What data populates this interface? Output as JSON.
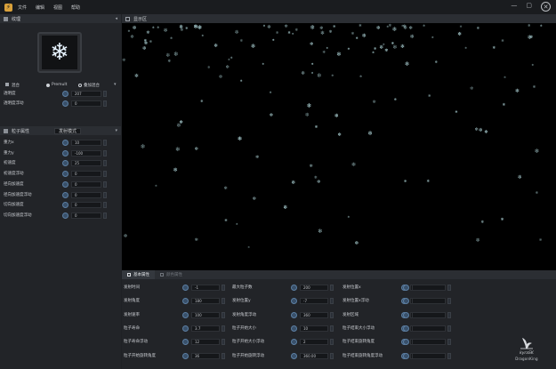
{
  "menu": [
    "文件",
    "编辑",
    "视图",
    "帮助"
  ],
  "left_panel": {
    "title": "纹理",
    "mode": {
      "label": "混合",
      "options": [
        "Premult",
        "叠加混合"
      ],
      "selected": "Premult"
    },
    "rows_top": [
      {
        "label": "透明度",
        "value": "207"
      },
      {
        "label": "透明度浮动",
        "value": "0"
      }
    ],
    "section2": {
      "title": "粒子属性",
      "dropdown": "发射模式"
    },
    "rows": [
      {
        "label": "重力x",
        "value": "10"
      },
      {
        "label": "重力y",
        "value": "-100"
      },
      {
        "label": "初速度",
        "value": "25"
      },
      {
        "label": "初速度浮动",
        "value": "0"
      },
      {
        "label": "径向加速度",
        "value": "0"
      },
      {
        "label": "径向加速度浮动",
        "value": "0"
      },
      {
        "label": "切向加速度",
        "value": "0"
      },
      {
        "label": "切向加速度浮动",
        "value": "0"
      }
    ]
  },
  "viewport": {
    "title": "显示区"
  },
  "bottom": {
    "tabs": [
      {
        "label": "基本属性",
        "active": true
      },
      {
        "label": "颜色属性",
        "active": false
      }
    ],
    "columns": [
      [
        {
          "label": "发射时间",
          "value": "-1"
        },
        {
          "label": "发射角度",
          "value": "180"
        },
        {
          "label": "发射速率",
          "value": "100"
        },
        {
          "label": "粒子寿命",
          "value": "3.7"
        },
        {
          "label": "粒子寿命浮动",
          "value": "12"
        },
        {
          "label": "粒子开始旋转角度",
          "value": "36"
        }
      ],
      [
        {
          "label": "最大粒子数",
          "value": "200"
        },
        {
          "label": "发射位置y",
          "value": "-7"
        },
        {
          "label": "发射角度浮动",
          "value": "360"
        },
        {
          "label": "粒子开始大小",
          "value": "10"
        },
        {
          "label": "粒子开始大小浮动",
          "value": "2"
        },
        {
          "label": "粒子开始旋转浮动",
          "value": "360.00"
        }
      ],
      [
        {
          "label": "发射位置x",
          "value": "470"
        },
        {
          "label": "发射位置x浮动",
          "value": "1"
        },
        {
          "label": "发射区域",
          "value": "1.01"
        },
        {
          "label": "粒子结束大小浮动",
          "value": "11"
        },
        {
          "label": "粒子结束旋转角度",
          "value": "1"
        },
        {
          "label": "粒子结束旋转角度浮动",
          "value": "356.97"
        }
      ]
    ]
  },
  "brand": {
    "name": "kyraSK",
    "sub": "DragonKing"
  }
}
